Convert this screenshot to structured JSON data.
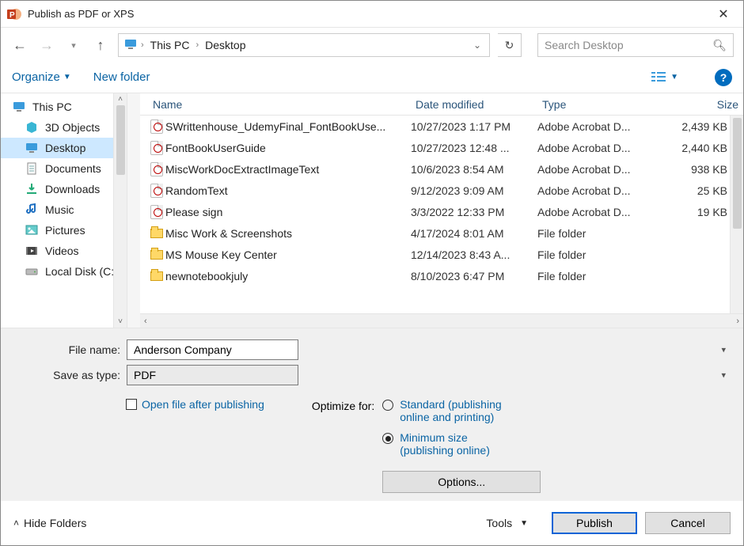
{
  "window_title": "Publish as PDF or XPS",
  "breadcrumbs": [
    "This PC",
    "Desktop"
  ],
  "search_placeholder": "Search Desktop",
  "toolbar": {
    "organize": "Organize",
    "new_folder": "New folder"
  },
  "sidebar": {
    "root": "This PC",
    "items": [
      {
        "name": "3D Objects",
        "icon": "3d"
      },
      {
        "name": "Desktop",
        "icon": "desktop",
        "selected": true
      },
      {
        "name": "Documents",
        "icon": "documents"
      },
      {
        "name": "Downloads",
        "icon": "downloads"
      },
      {
        "name": "Music",
        "icon": "music"
      },
      {
        "name": "Pictures",
        "icon": "pictures"
      },
      {
        "name": "Videos",
        "icon": "videos"
      },
      {
        "name": "Local Disk (C:)",
        "icon": "disk"
      }
    ]
  },
  "columns": {
    "name": "Name",
    "date": "Date modified",
    "type": "Type",
    "size": "Size"
  },
  "files": [
    {
      "icon": "pdf",
      "name": "SWrittenhouse_UdemyFinal_FontBookUse...",
      "date": "10/27/2023 1:17 PM",
      "type": "Adobe Acrobat D...",
      "size": "2,439 KB"
    },
    {
      "icon": "pdf",
      "name": "FontBookUserGuide",
      "date": "10/27/2023 12:48 ...",
      "type": "Adobe Acrobat D...",
      "size": "2,440 KB"
    },
    {
      "icon": "pdf",
      "name": "MiscWorkDocExtractImageText",
      "date": "10/6/2023 8:54 AM",
      "type": "Adobe Acrobat D...",
      "size": "938 KB"
    },
    {
      "icon": "pdf",
      "name": "RandomText",
      "date": "9/12/2023 9:09 AM",
      "type": "Adobe Acrobat D...",
      "size": "25 KB"
    },
    {
      "icon": "pdf",
      "name": "Please sign",
      "date": "3/3/2022 12:33 PM",
      "type": "Adobe Acrobat D...",
      "size": "19 KB"
    },
    {
      "icon": "folder",
      "name": "Misc Work & Screenshots",
      "date": "4/17/2024 8:01 AM",
      "type": "File folder",
      "size": ""
    },
    {
      "icon": "folder",
      "name": "MS Mouse Key Center",
      "date": "12/14/2023 8:43 A...",
      "type": "File folder",
      "size": ""
    },
    {
      "icon": "folder",
      "name": "newnotebookjuly",
      "date": "8/10/2023 6:47 PM",
      "type": "File folder",
      "size": ""
    }
  ],
  "file_name_label": "File name:",
  "file_name_value": "Anderson Company",
  "save_as_type_label": "Save as type:",
  "save_as_type_value": "PDF",
  "open_after_label": "Open file after publishing",
  "optimize_label": "Optimize for:",
  "optimize_options": {
    "standard": "Standard (publishing online and printing)",
    "minimum": "Minimum size (publishing online)",
    "selected": "minimum"
  },
  "options_button": "Options...",
  "hide_folders": "Hide Folders",
  "tools_label": "Tools",
  "publish_label": "Publish",
  "cancel_label": "Cancel"
}
